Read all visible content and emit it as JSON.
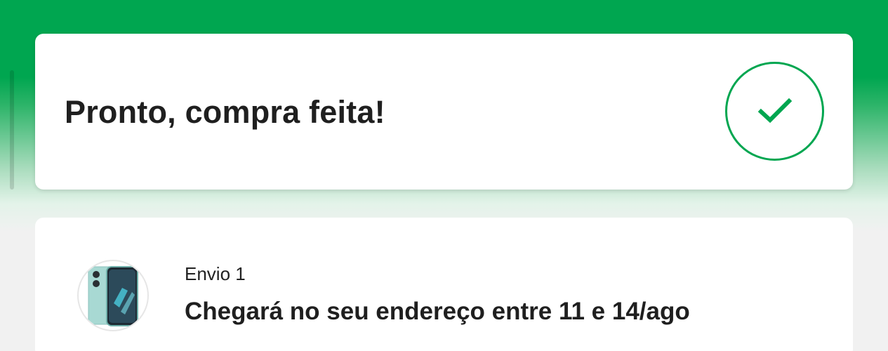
{
  "colors": {
    "brand_green": "#00a650",
    "card_background": "#ffffff",
    "page_background": "#f1f1f1",
    "text_primary": "#1f1f1f"
  },
  "success": {
    "title": "Pronto, compra feita!",
    "icon": "check-icon"
  },
  "shipment": {
    "label": "Envio 1",
    "delivery_text": "Chegará no seu endereço entre 11 e 14/ago",
    "product_icon": "smartphone-icon"
  }
}
